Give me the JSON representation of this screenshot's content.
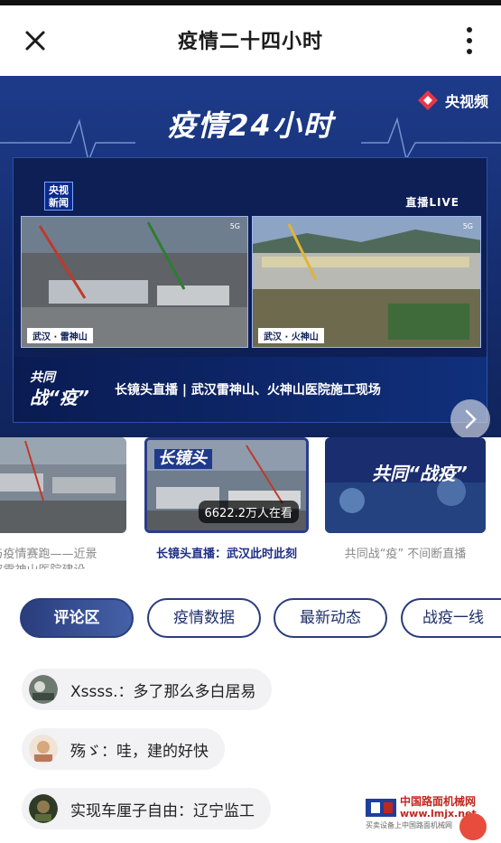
{
  "navbar": {
    "title": "疫情二十四小时",
    "close_icon": "close-icon",
    "more_icon": "more-vertical-icon"
  },
  "banner": {
    "title": "疫情24小时",
    "brand": "央视频",
    "video": {
      "badge": "央视\n新闻",
      "live": "直播LIVE",
      "frames": [
        {
          "caption": "武汉 · 雷神山"
        },
        {
          "caption": "武汉 · 火神山"
        }
      ],
      "slogan_line1": "共同",
      "slogan_line2": "战“疫”",
      "strip_text": "长镜头直播 | 武汉雷神山、火神山医院施工现场"
    }
  },
  "carousel": {
    "cards": [
      {
        "title": "与疫情赛跑——近景",
        "title2": "汉雷神山医院建设…",
        "selected": false
      },
      {
        "title": "长镜头直播：武汉此时此刻",
        "viewers": "6622.2万人在看",
        "overlay": "长镜头",
        "selected": true
      },
      {
        "title": "共同战“疫” 不间断直播",
        "overlay": "共同“战疫”",
        "selected": false
      }
    ]
  },
  "tabs": [
    {
      "label": "评论区",
      "active": true
    },
    {
      "label": "疫情数据",
      "active": false
    },
    {
      "label": "最新动态",
      "active": false
    },
    {
      "label": "战疫一线",
      "active": false
    }
  ],
  "comments": [
    {
      "text": "Xssss.：多了那么多白居易"
    },
    {
      "text": "殇ゞ：哇，建的好快"
    },
    {
      "text": "实现车厘子自由：辽宁监工"
    }
  ],
  "watermark": {
    "line1": "中国路面机械网",
    "line2": "www.lmjx.net",
    "line3": "买卖设备上中国路面机械网"
  },
  "colors": {
    "accent": "#2a3c7c",
    "banner": "#173074",
    "watermark": "#c0271f"
  }
}
